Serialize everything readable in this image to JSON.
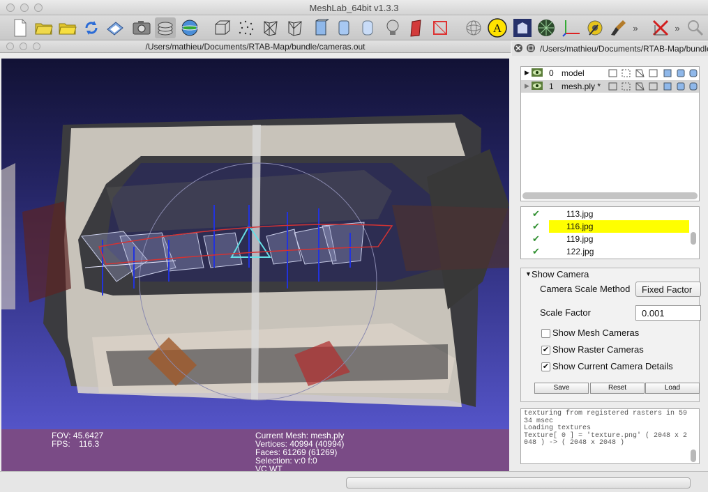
{
  "app": {
    "title": "MeshLab_64bit v1.3.3"
  },
  "document": {
    "title": "/Users/mathieu/Documents/RTAB-Map/bundle/cameras.out"
  },
  "toolbar": {
    "icons": [
      "new-file",
      "open-folder",
      "open-project",
      "reload",
      "save",
      "snapshot",
      "layers",
      "render-mode-earth",
      "bounding-box",
      "points",
      "wireframe",
      "hidden-lines",
      "flat-lines",
      "flat",
      "smooth",
      "texture",
      "light",
      "color-per-vertex",
      "select-vertices",
      "trackball",
      "annotate",
      "align",
      "manual-align",
      "axes",
      "measure",
      "paint",
      "more",
      "delete",
      "more2",
      "search"
    ]
  },
  "info": {
    "fov": "FOV: 45.6427",
    "fps_label": "FPS:",
    "fps_value": "116.3",
    "current_mesh": "Current Mesh: mesh.ply",
    "vertices": "Vertices: 40994 (40994)",
    "faces": "Faces: 61269 (61269)",
    "selection": "Selection: v:0 f:0",
    "vc": "VC WT"
  },
  "layers_dock": {
    "title": "/Users/mathieu/Documents/RTAB-Map/bundle/...",
    "layers": [
      {
        "index": "0",
        "name": "model"
      },
      {
        "index": "1",
        "name": "mesh.ply *"
      }
    ]
  },
  "rasters": [
    {
      "name": "113.jpg",
      "checked": true
    },
    {
      "name": "116.jpg",
      "checked": true,
      "highlighted": true
    },
    {
      "name": "119.jpg",
      "checked": true
    },
    {
      "name": "122.jpg",
      "checked": true
    }
  ],
  "show_camera": {
    "header": "Show Camera",
    "scale_method_label": "Camera Scale Method",
    "scale_method_value": "Fixed Factor",
    "scale_factor_label": "Scale Factor",
    "scale_factor_value": "0.001",
    "show_mesh_cameras": "Show Mesh Cameras",
    "show_mesh_cameras_checked": false,
    "show_raster_cameras": "Show Raster Cameras",
    "show_raster_cameras_checked": true,
    "show_current_camera_details": "Show Current Camera Details",
    "show_current_camera_details_checked": true,
    "save_label": "Save",
    "reset_label": "Reset",
    "load_label": "Load"
  },
  "log": {
    "text": "texturing from registered rasters in 5934 msec\nLoading textures\nTexture[ 0 ] = 'texture.png' ( 2048 x 2048 ) -> ( 2048 x 2048 )"
  },
  "colors": {
    "highlight": "#ffff00",
    "info_bar": "#7a4b86",
    "check": "#2f8f2f"
  }
}
